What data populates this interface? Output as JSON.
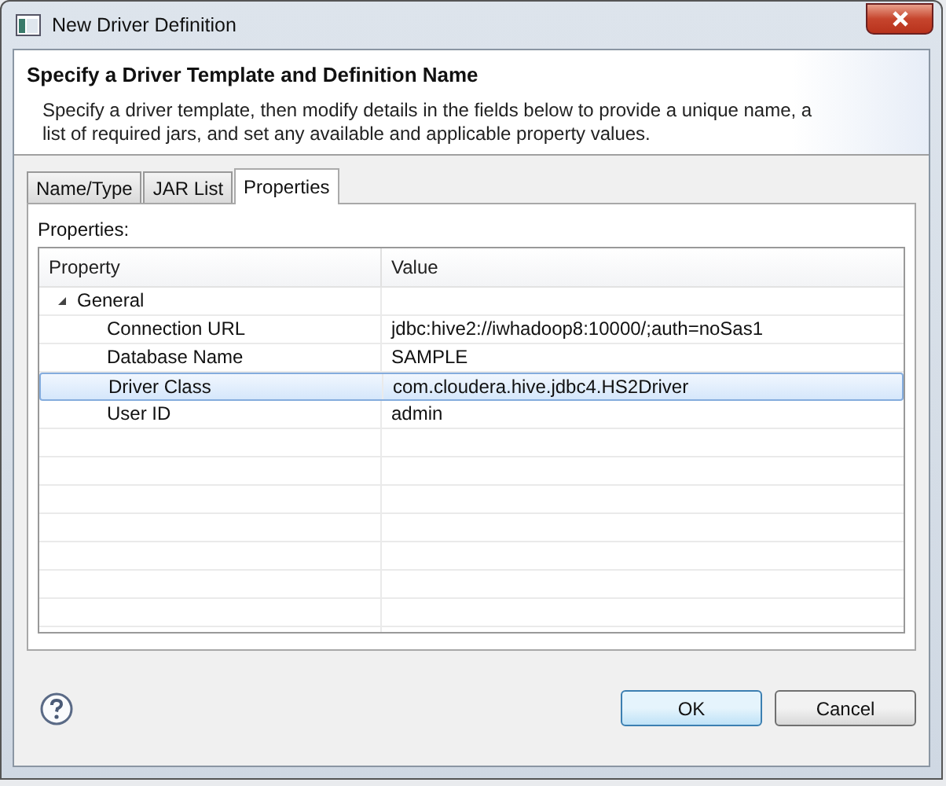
{
  "window": {
    "title": "New Driver Definition"
  },
  "header": {
    "title": "Specify a Driver Template and Definition Name",
    "description": "Specify a driver template, then modify details in the fields below to provide a unique name, a list of required jars, and set any available and applicable property values."
  },
  "tabs": [
    {
      "label": "Name/Type",
      "selected": false
    },
    {
      "label": "JAR List",
      "selected": false
    },
    {
      "label": "Properties",
      "selected": true
    }
  ],
  "properties": {
    "label": "Properties:",
    "columns": [
      "Property",
      "Value"
    ],
    "groups": [
      {
        "label": "General",
        "expanded": true,
        "children": [
          {
            "property": "Connection URL",
            "value": "jdbc:hive2://iwhadoop8:10000/;auth=noSas1",
            "selected": false
          },
          {
            "property": "Database Name",
            "value": "SAMPLE",
            "selected": false
          },
          {
            "property": "Driver Class",
            "value": "com.cloudera.hive.jdbc4.HS2Driver",
            "selected": true
          },
          {
            "property": "User ID",
            "value": "admin",
            "selected": false
          }
        ]
      }
    ]
  },
  "buttons": [
    {
      "label": "OK",
      "default": true
    },
    {
      "label": "Cancel",
      "default": false
    }
  ]
}
